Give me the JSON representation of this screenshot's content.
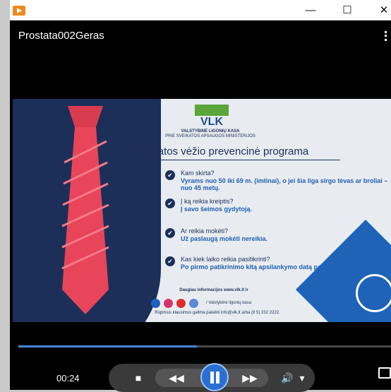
{
  "window": {
    "title_controls": [
      "—",
      "☐",
      "✕"
    ]
  },
  "video": {
    "title": "Prostata002Geras",
    "progress": 0.48,
    "time": "00:24"
  },
  "slide": {
    "logo_text": "VLK",
    "org_name": "VALSTYBINĖ LIGONIŲ KASA",
    "org_sub": "PRIE SVEIKATOS APSAUGOS MINISTERIJOS",
    "heading": "Prostatos vėžio prevencinė programa",
    "items": [
      {
        "q": "Kam skirta?",
        "a": "Vyrams nuo 50 iki 69 m. (imtinai), o jei šia liga sirgo tėvas ar broliai – nuo 45 metų."
      },
      {
        "q": "Į ką reikia kreiptis?",
        "a": "Į savo šeimos gydytoją."
      },
      {
        "q": "Ar reikia mokėti?",
        "a": "Už paslaugą mokėti nereikia."
      },
      {
        "q": "Kas kiek laiko reikia pasitikrinti?",
        "a": "Po pirmo patikrinimo kitą apsilankymo datą paskirs šeimos gydytojas."
      }
    ],
    "footer_info": "Daugiau informacijos www.vlk.lt ir",
    "social_text": "/ Valstybinė ligonių kasa",
    "footer_contact": "Rūpimus klausimus galima pateikti info@vlk.lt arba (8 5) 232 2222."
  },
  "colors": {
    "accent": "#2b6fd0",
    "navy": "#1c2f58",
    "tie": "#e8455a"
  }
}
